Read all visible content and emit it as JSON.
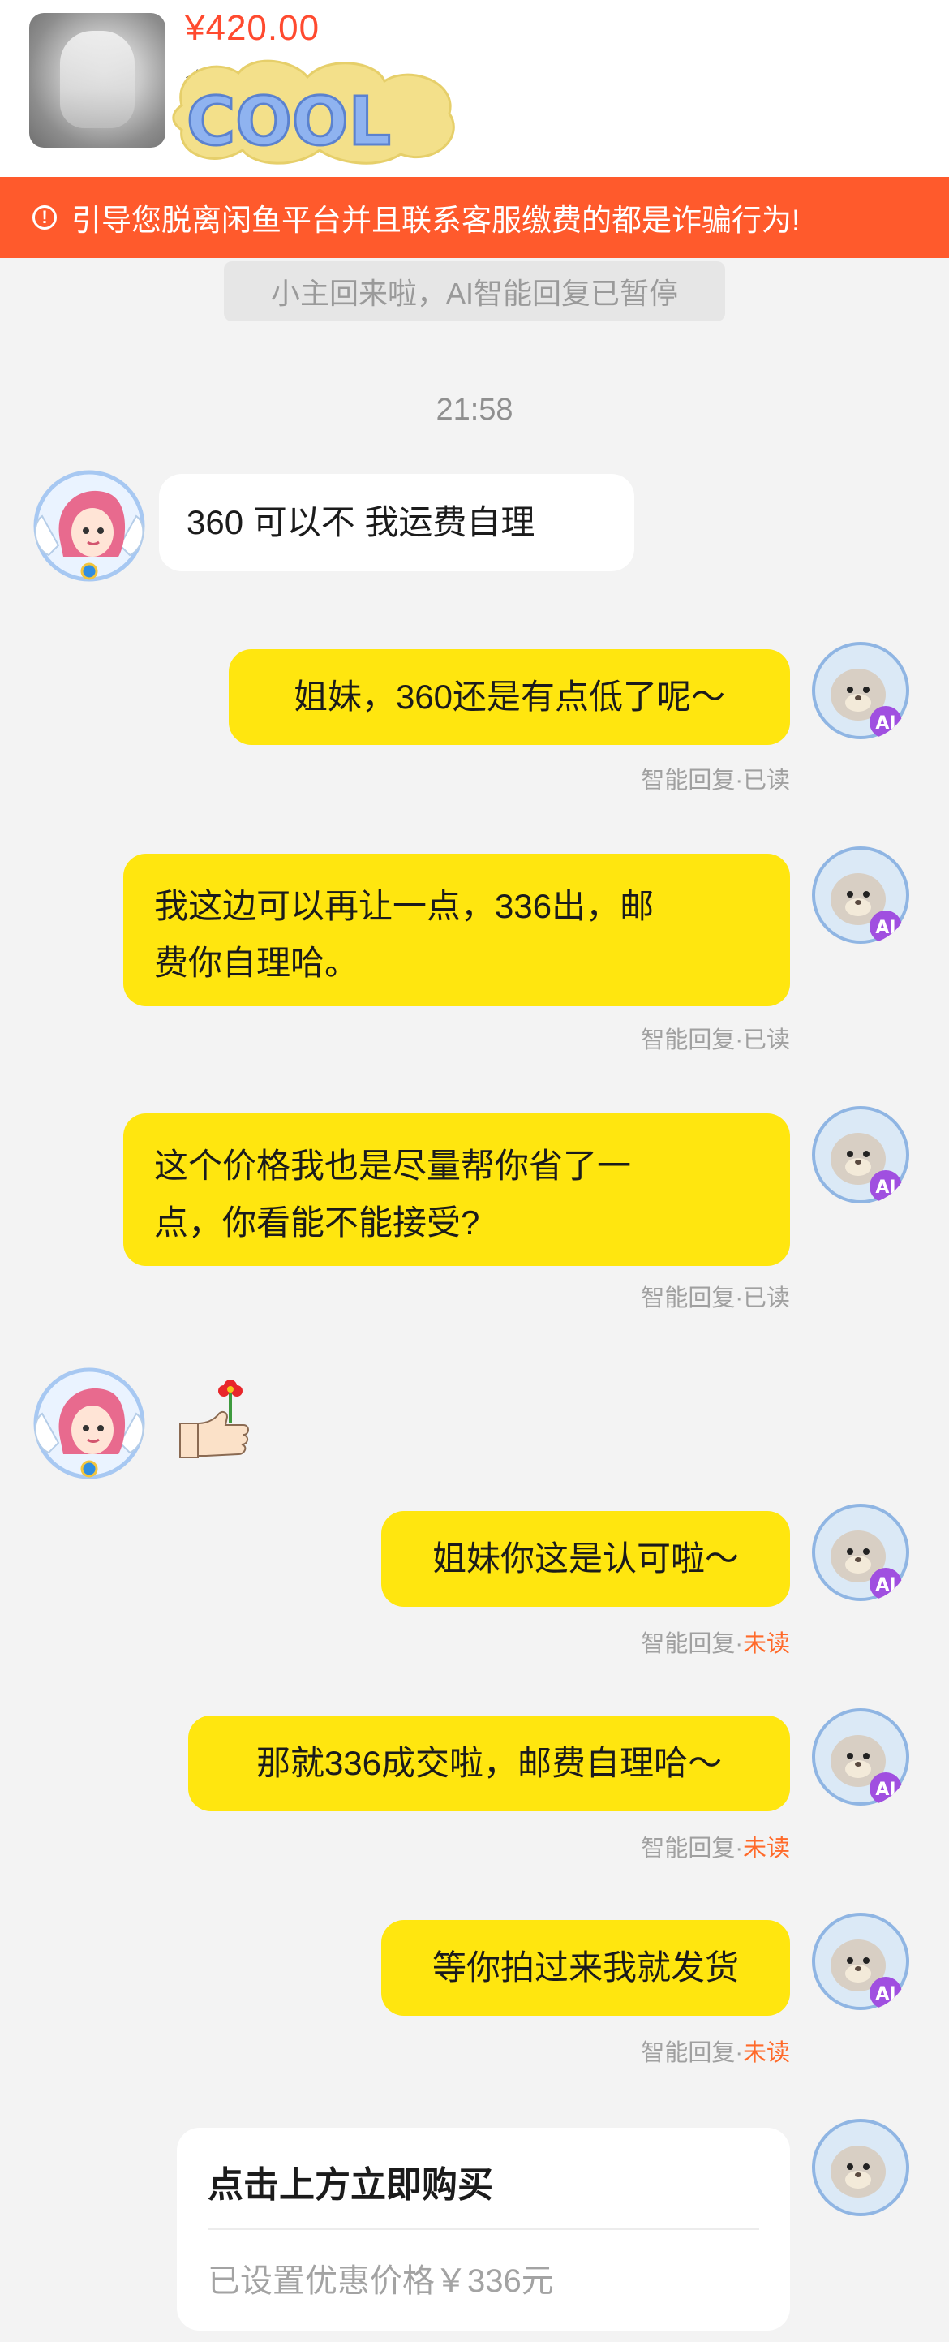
{
  "product": {
    "price": "¥420.00",
    "price_sub": "含",
    "sticker_text": "COOL"
  },
  "warning": {
    "icon": "info-circle-icon",
    "text": "引导您脱离闲鱼平台并且联系客服缴费的都是诈骗行为!"
  },
  "system_note": "小主回来啦，AI智能回复已暂停",
  "timestamp": "21:58",
  "messages": [
    {
      "side": "in",
      "text": "360 可以不  我运费自理"
    },
    {
      "side": "out",
      "text": "姐妹，360还是有点低了呢～",
      "status_prefix": "智能回复·",
      "status": "已读"
    },
    {
      "side": "out",
      "lines": [
        "我这边可以再让一点，336出，邮",
        "费你自理哈。"
      ],
      "status_prefix": "智能回复·",
      "status": "已读"
    },
    {
      "side": "out",
      "lines": [
        "这个价格我也是尽量帮你省了一",
        "点，你看能不能接受?"
      ],
      "status_prefix": "智能回复·",
      "status": "已读"
    },
    {
      "side": "in",
      "emoji": "thumbs-up-flower-emoji"
    },
    {
      "side": "out",
      "text": "姐妹你这是认可啦～",
      "status_prefix": "智能回复·",
      "status": "未读"
    },
    {
      "side": "out",
      "text": "那就336成交啦，邮费自理哈～",
      "status_prefix": "智能回复·",
      "status": "未读"
    },
    {
      "side": "out",
      "text": "等你拍过来我就发货",
      "status_prefix": "智能回复·",
      "status": "未读"
    }
  ],
  "card": {
    "title": "点击上方立即购买",
    "subtitle": "已设置优惠价格￥336元"
  },
  "colors": {
    "price": "#ff4a2f",
    "warning_bg": "#ff5a2c",
    "bubble_out": "#ffe60f",
    "unread": "#ff6a2a"
  },
  "ai_badge": "AI"
}
